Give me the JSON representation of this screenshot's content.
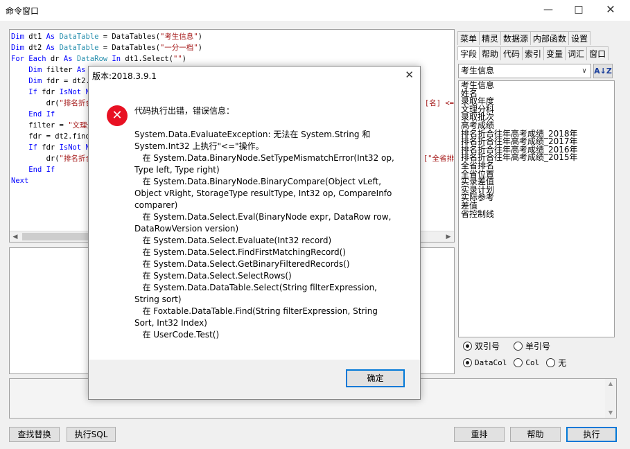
{
  "window": {
    "title": "命令窗口"
  },
  "editor": {
    "lines": [
      [
        [
          "kw",
          "Dim "
        ],
        [
          "p",
          "dt1 "
        ],
        [
          "kw",
          "As "
        ],
        [
          "ty",
          "DataTable"
        ],
        [
          "p",
          " = DataTables("
        ],
        [
          "st",
          "\"考生信息\""
        ],
        [
          "p",
          ")"
        ]
      ],
      [
        [
          "kw",
          "Dim "
        ],
        [
          "p",
          "dt2 "
        ],
        [
          "kw",
          "As "
        ],
        [
          "ty",
          "DataTable"
        ],
        [
          "p",
          " = DataTables("
        ],
        [
          "st",
          "\"一分一档\""
        ],
        [
          "p",
          ")"
        ]
      ],
      [
        [
          "kw",
          "For Each "
        ],
        [
          "p",
          "dr "
        ],
        [
          "kw",
          "As "
        ],
        [
          "ty",
          "DataRow "
        ],
        [
          "kw",
          "In "
        ],
        [
          "p",
          "dt1.Select("
        ],
        [
          "st",
          "\"\""
        ],
        [
          "p",
          ")"
        ]
      ],
      [
        [
          "p",
          "    "
        ],
        [
          "kw",
          "Dim "
        ],
        [
          "p",
          "filter "
        ],
        [
          "kw",
          "As "
        ],
        [
          "ty",
          "S"
        ]
      ],
      [
        [
          "p",
          "    "
        ],
        [
          "kw",
          "Dim "
        ],
        [
          "p",
          "fdr = dt2.f"
        ]
      ],
      [
        [
          "p",
          "    "
        ],
        [
          "kw",
          "If "
        ],
        [
          "p",
          "fdr "
        ],
        [
          "kw",
          "IsNot No"
        ]
      ],
      [
        [
          "p",
          "        dr("
        ],
        [
          "st",
          "\"排名折合"
        ]
      ],
      [
        [
          "p",
          "    "
        ],
        [
          "kw",
          "End If"
        ]
      ],
      [
        [
          "p",
          "    filter = "
        ],
        [
          "st",
          "\"文理分"
        ]
      ],
      [
        [
          "p",
          "    fdr = dt2.find("
        ]
      ],
      [
        [
          "p",
          "    "
        ],
        [
          "kw",
          "If "
        ],
        [
          "p",
          "fdr "
        ],
        [
          "kw",
          "IsNot No"
        ]
      ],
      [
        [
          "p",
          "        dr("
        ],
        [
          "st",
          "\"排名折合"
        ]
      ],
      [
        [
          "p",
          "    "
        ],
        [
          "kw",
          "End If"
        ]
      ],
      [
        [
          "kw",
          "Next"
        ]
      ]
    ],
    "overflow_right": [
      {
        "text": "[名] <=",
        "row": 6,
        "color": "#a31515"
      },
      {
        "text": "[\"全省排",
        "row": 11,
        "color": "#a31515"
      }
    ]
  },
  "side_tabs": {
    "row1": [
      "菜单",
      "精灵",
      "数据源",
      "内部函数",
      "设置"
    ],
    "row2": [
      "字段",
      "帮助",
      "代码",
      "索引",
      "变量",
      "词汇",
      "窗口"
    ],
    "active": "字段"
  },
  "table_combo": {
    "value": "考生信息"
  },
  "sort_button_label": "A↓Z",
  "fields": [
    "考生信息",
    "姓名",
    "录取年度",
    "文理分科",
    "录取批次",
    "高考成绩",
    "排名折合往年高考成绩_2018年",
    "排名折合往年高考成绩_2017年",
    "排名折合往年高考成绩_2016年",
    "排名折合往年高考成绩_2015年",
    "全省排名",
    "全省位置",
    "实录差值",
    "实录计划",
    "实际参考",
    "差值",
    "省控制线"
  ],
  "quote_options": {
    "option1": "双引号",
    "option2": "单引号",
    "selected": "双引号"
  },
  "column_options": {
    "option1": "DataCol",
    "option2": "Col",
    "option3": "无",
    "selected": "DataCol"
  },
  "buttons": {
    "find_replace": "查找替换",
    "exec_sql": "执行SQL",
    "reorder": "重排",
    "help": "帮助",
    "execute": "执行"
  },
  "dialog": {
    "title": "版本:2018.3.9.1",
    "heading": "代码执行出错，错误信息：",
    "lines": [
      "System.Data.EvaluateException: 无法在 System.String 和 System.Int32 上执行\"<=\"操作。",
      "   在 System.Data.BinaryNode.SetTypeMismatchError(Int32 op, Type left, Type right)",
      "   在 System.Data.BinaryNode.BinaryCompare(Object vLeft, Object vRight, StorageType resultType, Int32 op, CompareInfo comparer)",
      "   在 System.Data.Select.Eval(BinaryNode expr, DataRow row, DataRowVersion version)",
      "   在 System.Data.Select.Evaluate(Int32 record)",
      "   在 System.Data.Select.FindFirstMatchingRecord()",
      "   在 System.Data.Select.GetBinaryFilteredRecords()",
      "   在 System.Data.Select.SelectRows()",
      "   在 System.Data.DataTable.Select(String filterExpression, String sort)",
      "   在 Foxtable.DataTable.Find(String filterExpression, String Sort, Int32 Index)",
      "   在 UserCode.Test()"
    ],
    "ok_label": "确定"
  }
}
